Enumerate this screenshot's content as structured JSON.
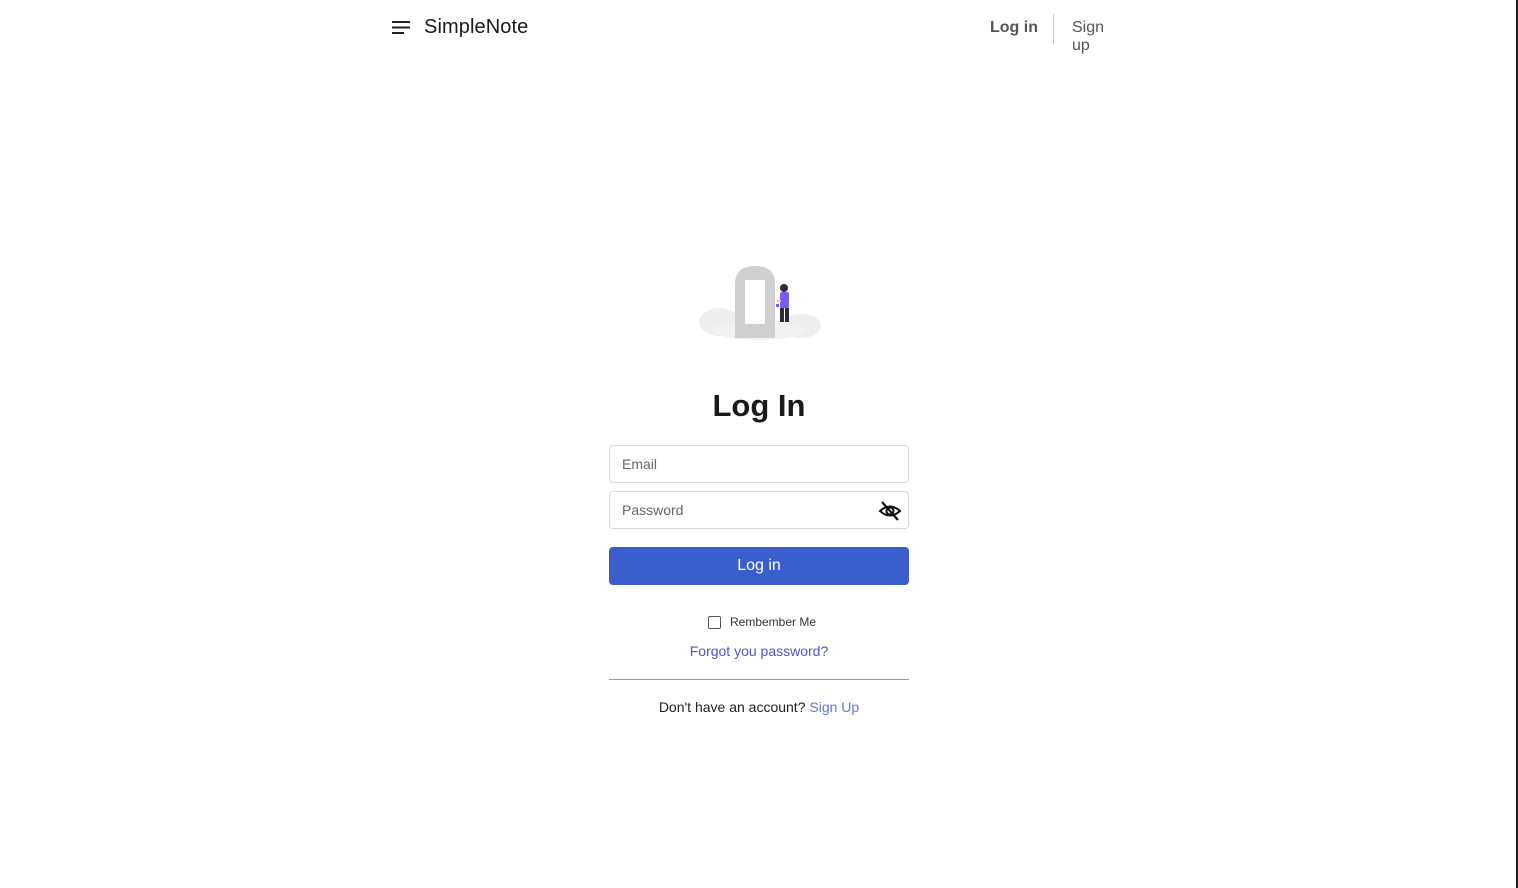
{
  "header": {
    "brand": "SimpleNote",
    "nav_login": "Log in",
    "nav_signup": "Sign up"
  },
  "form": {
    "title": "Log In",
    "email_placeholder": "Email",
    "email_value": "",
    "password_placeholder": "Password",
    "password_value": "",
    "login_button": "Log in",
    "remember_label": "Rembember Me",
    "remember_checked": false,
    "forgot_link": "Forgot you password?",
    "no_account_text": "Don't have an account?",
    "signup_link": "Sign Up"
  },
  "icons": {
    "menu": "menu-icon",
    "password_visibility": "eye-off-icon",
    "illustration": "login-illustration"
  },
  "colors": {
    "primary_button": "#3a5fcd",
    "link": "#4a55c8",
    "signup_link": "#5a7bd8",
    "illustration_accent": "#7b5cf2"
  }
}
